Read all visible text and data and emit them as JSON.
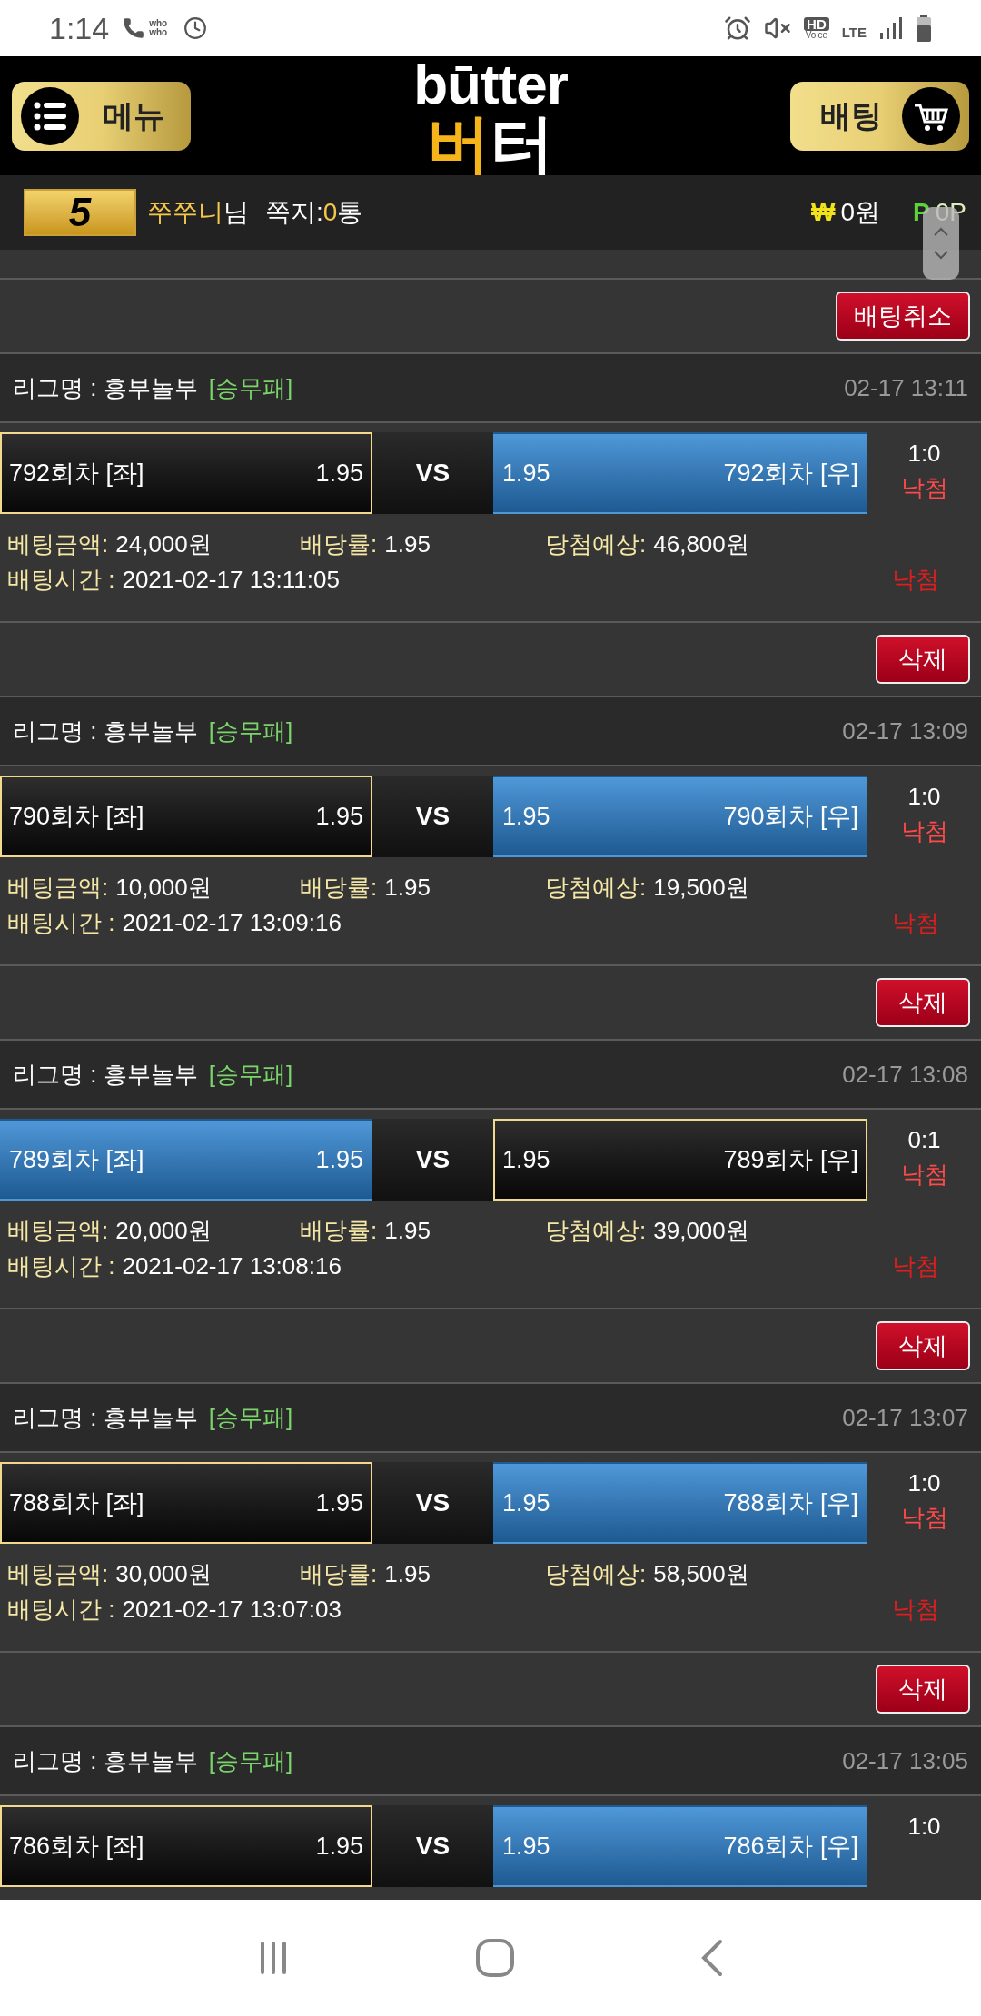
{
  "status_bar": {
    "time": "1:14",
    "call_app": "who who",
    "hd": "HD",
    "voice": "Voice",
    "network": "LTE"
  },
  "header": {
    "menu_button": "메뉴",
    "logo_top": "būtter",
    "logo_bottom_left": "버",
    "logo_bottom_right": "터",
    "bet_button": "배팅"
  },
  "user_bar": {
    "level": "5",
    "username": "쭈쭈니",
    "honorific": "님",
    "messages_label": "쪽지:",
    "messages_count": "0",
    "messages_unit": "통",
    "currency_sign": "₩",
    "money": "0원",
    "points_sign": "P",
    "points": "0P"
  },
  "bets": [
    {
      "action": "배팅취소",
      "league": "리그명 : 흥부놀부",
      "market": "[승무패]",
      "time": "02-17 13:11",
      "left": {
        "name": "792회차 [좌]",
        "odds": "1.95",
        "selected": false
      },
      "vs": "VS",
      "right": {
        "name": "792회차 [우]",
        "odds": "1.95",
        "selected": true
      },
      "score": "1:0",
      "score_result": "낙첨",
      "amount_label": "베팅금액:",
      "amount": "24,000원",
      "rate_label": "배당률:",
      "rate": "1.95",
      "expected_label": "당첨예상:",
      "expected": "46,800원",
      "time_label": "배팅시간 :",
      "bet_time": "2021-02-17 13:11:05",
      "result": "낙첨"
    },
    {
      "action": "삭제",
      "league": "리그명 : 흥부놀부",
      "market": "[승무패]",
      "time": "02-17 13:09",
      "left": {
        "name": "790회차 [좌]",
        "odds": "1.95",
        "selected": false
      },
      "vs": "VS",
      "right": {
        "name": "790회차 [우]",
        "odds": "1.95",
        "selected": true
      },
      "score": "1:0",
      "score_result": "낙첨",
      "amount_label": "베팅금액:",
      "amount": "10,000원",
      "rate_label": "배당률:",
      "rate": "1.95",
      "expected_label": "당첨예상:",
      "expected": "19,500원",
      "time_label": "배팅시간 :",
      "bet_time": "2021-02-17 13:09:16",
      "result": "낙첨"
    },
    {
      "action": "삭제",
      "league": "리그명 : 흥부놀부",
      "market": "[승무패]",
      "time": "02-17 13:08",
      "left": {
        "name": "789회차 [좌]",
        "odds": "1.95",
        "selected": true
      },
      "vs": "VS",
      "right": {
        "name": "789회차 [우]",
        "odds": "1.95",
        "selected": false
      },
      "score": "0:1",
      "score_result": "낙첨",
      "amount_label": "베팅금액:",
      "amount": "20,000원",
      "rate_label": "배당률:",
      "rate": "1.95",
      "expected_label": "당첨예상:",
      "expected": "39,000원",
      "time_label": "배팅시간 :",
      "bet_time": "2021-02-17 13:08:16",
      "result": "낙첨"
    },
    {
      "action": "삭제",
      "league": "리그명 : 흥부놀부",
      "market": "[승무패]",
      "time": "02-17 13:07",
      "left": {
        "name": "788회차 [좌]",
        "odds": "1.95",
        "selected": false
      },
      "vs": "VS",
      "right": {
        "name": "788회차 [우]",
        "odds": "1.95",
        "selected": true
      },
      "score": "1:0",
      "score_result": "낙첨",
      "amount_label": "베팅금액:",
      "amount": "30,000원",
      "rate_label": "배당률:",
      "rate": "1.95",
      "expected_label": "당첨예상:",
      "expected": "58,500원",
      "time_label": "배팅시간 :",
      "bet_time": "2021-02-17 13:07:03",
      "result": "낙첨"
    },
    {
      "action": "삭제",
      "league": "리그명 : 흥부놀부",
      "market": "[승무패]",
      "time": "02-17 13:05",
      "left": {
        "name": "786회차 [좌]",
        "odds": "1.95",
        "selected": false
      },
      "vs": "VS",
      "right": {
        "name": "786회차 [우]",
        "odds": "1.95",
        "selected": true
      },
      "score": "1:0"
    }
  ]
}
